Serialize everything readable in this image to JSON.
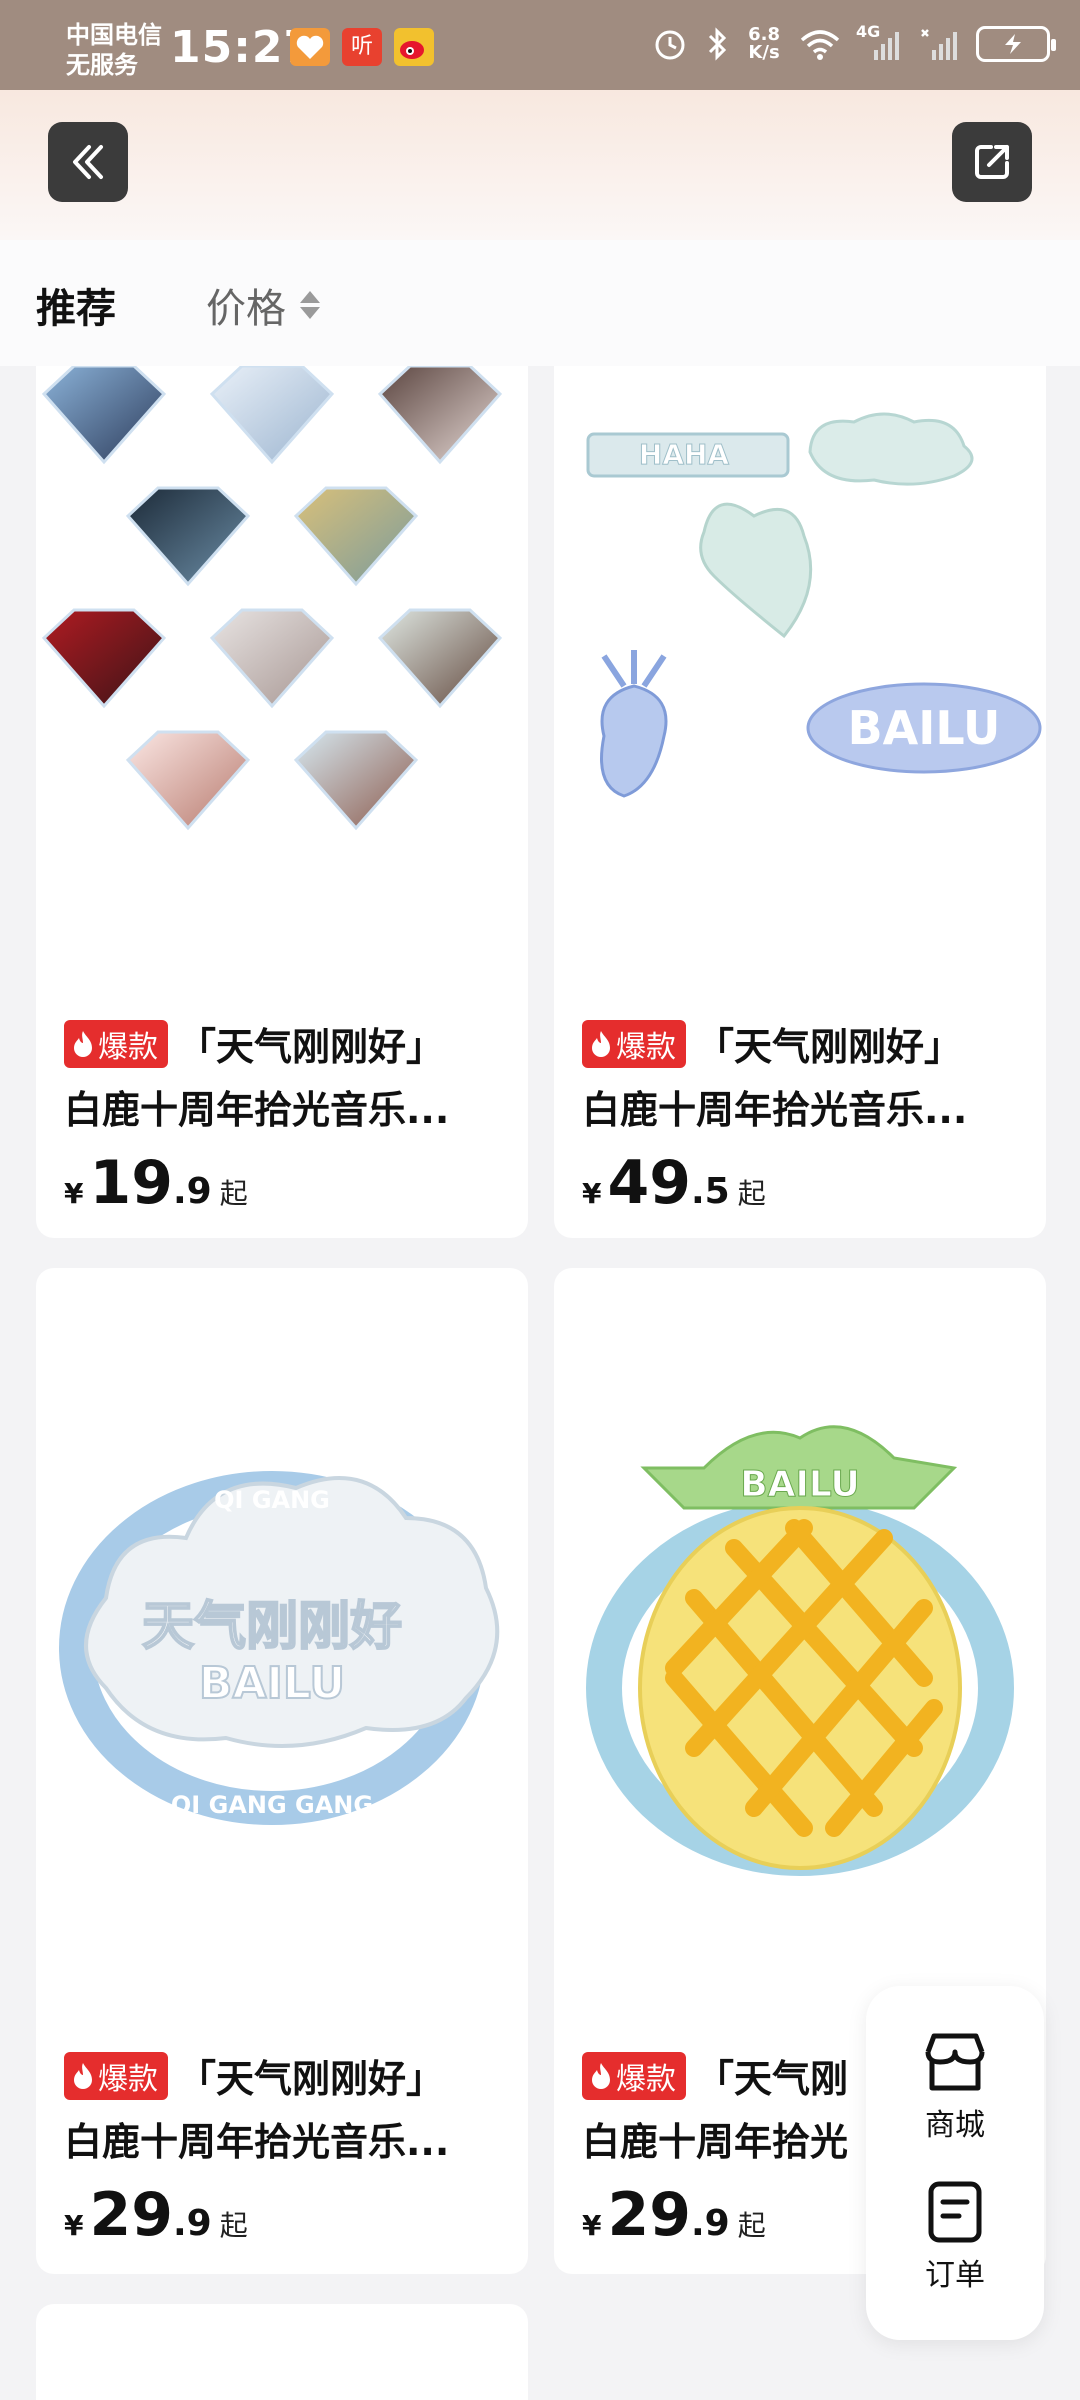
{
  "status_bar": {
    "carrier_line1": "中国电信",
    "carrier_line2": "无服务",
    "time": "15:27",
    "net_speed_value": "6.8",
    "net_speed_unit": "K/s",
    "signal_label": "4G",
    "apps": [
      "heart-app-icon",
      "ting-app-icon",
      "weibo-app-icon"
    ],
    "app_ting_label": "听"
  },
  "header": {
    "back_icon": "double-chevron-left-icon",
    "share_icon": "share-icon"
  },
  "tabs": {
    "recommend_label": "推荐",
    "price_label": "价格"
  },
  "products": [
    {
      "badge": "爆款",
      "title_line1": "「天气刚刚好」",
      "title_line2": "白鹿十周年拾光音乐...",
      "currency": "¥",
      "price_int": "19",
      "price_dec": ".9",
      "price_suffix": "起",
      "image_desc": "diamond-photo-badges"
    },
    {
      "badge": "爆款",
      "title_line1": "「天气刚刚好」",
      "title_line2": "白鹿十周年拾光音乐...",
      "currency": "¥",
      "price_int": "49",
      "price_dec": ".5",
      "price_suffix": "起",
      "image_desc": "acrylic-stickers",
      "sticker_text_haha": "HAHA",
      "sticker_text_bailu": "BAILU"
    },
    {
      "badge": "爆款",
      "title_line1": "「天气刚刚好」",
      "title_line2": "白鹿十周年拾光音乐...",
      "currency": "¥",
      "price_int": "29",
      "price_dec": ".9",
      "price_suffix": "起",
      "image_desc": "cloud-acrylic",
      "image_text_main": "天气刚刚好",
      "image_text_sub": "BAILU",
      "image_ring_top": "QI GANG",
      "image_ring_bottom": "QI GANG GANG"
    },
    {
      "badge": "爆款",
      "title_line1": "「天气刚",
      "title_line2": "白鹿十周年拾光",
      "currency": "¥",
      "price_int": "29",
      "price_dec": ".9",
      "price_suffix": "起",
      "image_desc": "pineapple-acrylic",
      "image_text": "BAILU"
    }
  ],
  "float_panel": {
    "mall_label": "商城",
    "orders_label": "订单"
  },
  "colors": {
    "status_bar": "#a08c80",
    "badge_red": "#e52d2d",
    "header_gradient_top": "#f8e8df"
  }
}
